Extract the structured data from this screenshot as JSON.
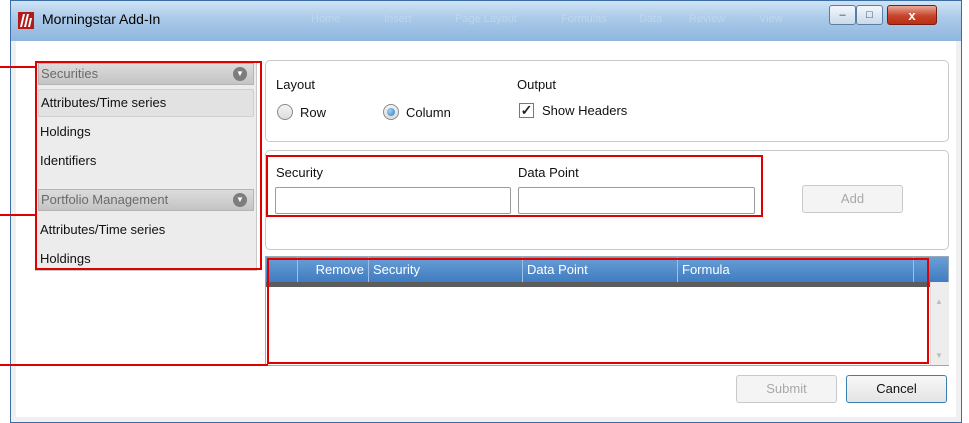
{
  "window": {
    "title": "Morningstar Add-In",
    "controls": {
      "minimize": "–",
      "maximize": "□",
      "close": "x"
    },
    "ghost_tabs": [
      "Home",
      "Insert",
      "Page Layout",
      "Formulas",
      "Data",
      "Review",
      "View"
    ]
  },
  "nav": {
    "sections": [
      {
        "label": "Securities",
        "items": [
          "Attributes/Time series",
          "Holdings",
          "Identifiers"
        ]
      },
      {
        "label": "Portfolio Management",
        "items": [
          "Attributes/Time series",
          "Holdings"
        ]
      }
    ],
    "chevron": "▼",
    "selected_item": "Attributes/Time series"
  },
  "layout_group": {
    "label": "Layout",
    "options": [
      {
        "label": "Row",
        "selected": false
      },
      {
        "label": "Column",
        "selected": true
      }
    ]
  },
  "output_group": {
    "label": "Output",
    "checkbox_label": "Show Headers",
    "checked": true,
    "check_glyph": "✓"
  },
  "entry": {
    "security_label": "Security",
    "security_value": "",
    "datapoint_label": "Data Point",
    "datapoint_value": "",
    "add_label": "Add"
  },
  "grid": {
    "columns": [
      "",
      "Remove",
      "Security",
      "Data Point",
      "Formula"
    ],
    "rows": []
  },
  "footer": {
    "submit_label": "Submit",
    "cancel_label": "Cancel"
  },
  "colors": {
    "callout": "#e00000",
    "grid_header": "#4a87c8",
    "radio_accent": "#2c7fc8"
  }
}
